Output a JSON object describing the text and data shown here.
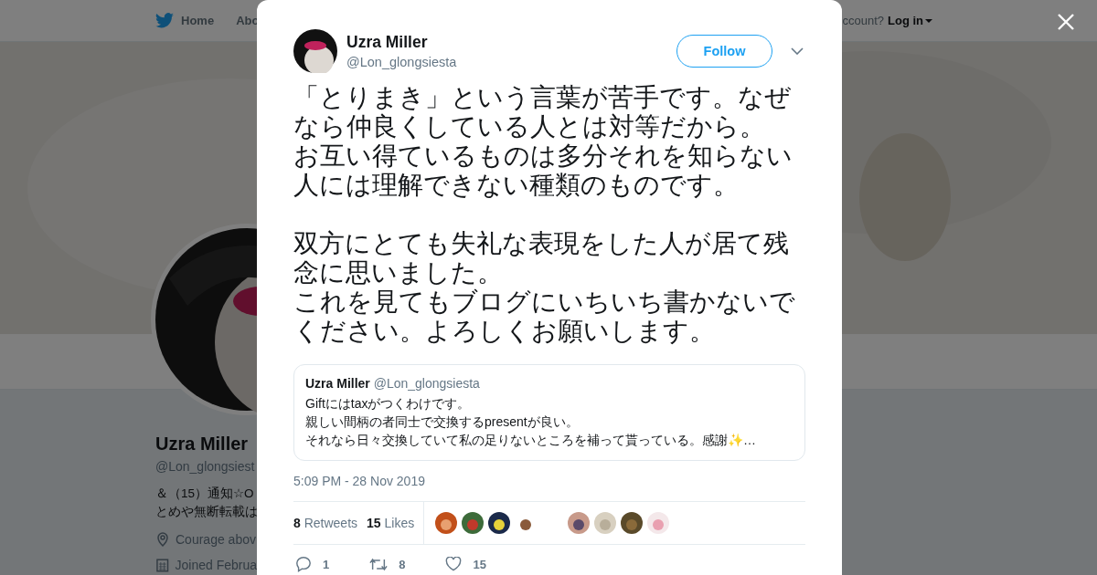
{
  "background_page": {
    "nav": [
      {
        "label": "Home"
      },
      {
        "label": "Abo"
      }
    ],
    "account_prompt": "ccount?",
    "login": "Log in",
    "profile": {
      "name": "Uzra Miller",
      "handle": "@Lon_glongsiest",
      "bio": [
        "＆（15）通知☆O",
        "とめや無断転載は"
      ],
      "location": "Courage abov",
      "joined": "Joined Februa"
    }
  },
  "tweet": {
    "author": {
      "name": "Uzra Miller",
      "handle": "@Lon_glongsiesta"
    },
    "follow_button": "Follow",
    "paragraphs": [
      {
        "lines": [
          "「とりまき」という言葉が苦手です。なぜなら仲良くしている人とは対等だから。",
          "お互い得ているものは多分それを知らない人には理解できない種類のものです。"
        ]
      },
      {
        "lines": [
          "双方にとても失礼な表現をした人が居て残念に思いました。",
          "これを見てもブログにいちいち書かないでください。よろしくお願いします。"
        ]
      }
    ],
    "quoted": {
      "name": "Uzra Miller",
      "handle": "@Lon_glongsiesta",
      "lines": [
        "Giftにはtaxがつくわけです。",
        "親しい間柄の者同士で交換するpresentが良い。",
        "それなら日々交換していて私の足りないところを補って貰っている。感謝✨…"
      ]
    },
    "timestamp": "5:09 PM - 28 Nov 2019",
    "stats": [
      {
        "count": "8",
        "label": "Retweets"
      },
      {
        "count": "15",
        "label": "Likes"
      }
    ],
    "likers": [
      {
        "kind": "picture"
      },
      {
        "kind": "picture"
      },
      {
        "kind": "picture"
      },
      {
        "kind": "picture"
      },
      {
        "kind": "empty"
      },
      {
        "kind": "picture"
      },
      {
        "kind": "picture"
      },
      {
        "kind": "picture"
      },
      {
        "kind": "picture"
      }
    ],
    "actions": [
      {
        "kind": "reply",
        "count": "1"
      },
      {
        "kind": "retweet",
        "count": "8"
      },
      {
        "kind": "like",
        "count": "15"
      }
    ]
  }
}
